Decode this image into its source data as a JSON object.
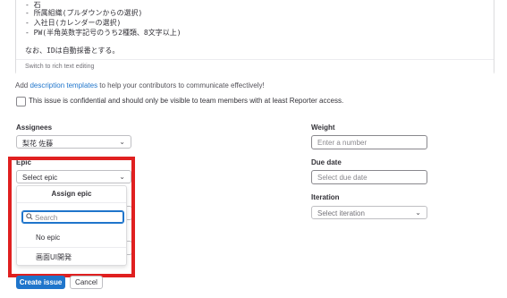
{
  "editor": {
    "lines": [
      "- 石",
      "- 所属組織(プルダウンからの選択)",
      "- 入社日(カレンダーの選択)",
      "- PW(半角英数字記号のうち2種類、8文字以上)",
      "",
      "なお、IDは自動採番とする。"
    ],
    "footer": "Switch to rich text editing"
  },
  "help": {
    "prefix": "Add ",
    "link": "description templates",
    "suffix": " to help your contributors to communicate effectively!"
  },
  "confidential_label": "This issue is confidential and should only be visible to team members with at least Reporter access.",
  "assignees": {
    "label": "Assignees",
    "value": "梨花 佐藤"
  },
  "epic": {
    "label": "Epic",
    "value": "Select epic",
    "menu": {
      "header": "Assign epic",
      "search_placeholder": "Search",
      "items": [
        "No epic",
        "画面UI開発"
      ]
    }
  },
  "weight": {
    "label": "Weight",
    "placeholder": "Enter a number"
  },
  "due_date": {
    "label": "Due date",
    "placeholder": "Select due date"
  },
  "iteration": {
    "label": "Iteration",
    "value": "Select iteration"
  },
  "actions": {
    "create": "Create issue",
    "cancel": "Cancel"
  },
  "colors": {
    "primary": "#1f75cb",
    "highlight": "#e02020"
  }
}
